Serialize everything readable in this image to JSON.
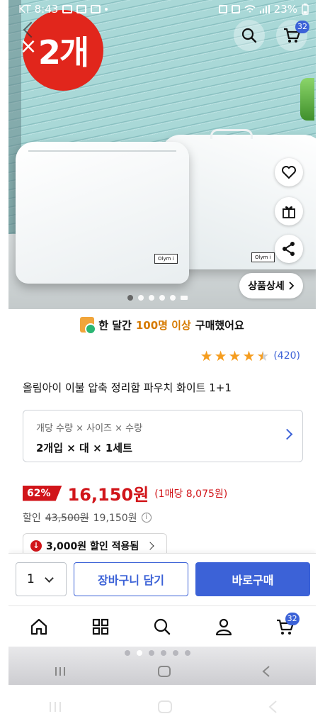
{
  "status_bar": {
    "carrier_time": "KT 8:43",
    "battery": "23%"
  },
  "hero": {
    "badge_text": "2개",
    "close_glyph": "×",
    "cart_count": "32",
    "bag_tag_1": "Olym i",
    "bag_tag_2": "Olym i",
    "detail_button": "상품상세"
  },
  "purchase_banner": {
    "prefix": "한 달간",
    "highlight": "100명 이상",
    "suffix": "구매했어요"
  },
  "rating": {
    "stars": 4.5,
    "review_count": "(420)"
  },
  "product": {
    "title": "올림아이 이불 압축 정리함 파우치 화이트 1+1"
  },
  "option": {
    "label": "개당 수량 × 사이즈 × 수량",
    "value": "2개입 × 대 × 1세트"
  },
  "price": {
    "discount": "62%",
    "sale_price": "16,150원",
    "unit_price": "(1매당 8,075원)",
    "discount_label": "할인",
    "original_price": "43,500원",
    "discounted_price": "19,150원",
    "info_glyph": "i",
    "coupon": "3,000원 할인 적용됨"
  },
  "buy_bar": {
    "quantity": "1",
    "cart_button": "장바구니 담기",
    "buy_button": "바로구매"
  },
  "bottom_nav": {
    "cart_badge": "32",
    "items": [
      "home-icon",
      "category-icon",
      "search-icon",
      "my-account-icon",
      "cart-icon"
    ]
  },
  "colors": {
    "accent": "#3c62d7",
    "sale": "#d1151a",
    "highlight": "#d67a00",
    "star": "#f59d1f"
  }
}
